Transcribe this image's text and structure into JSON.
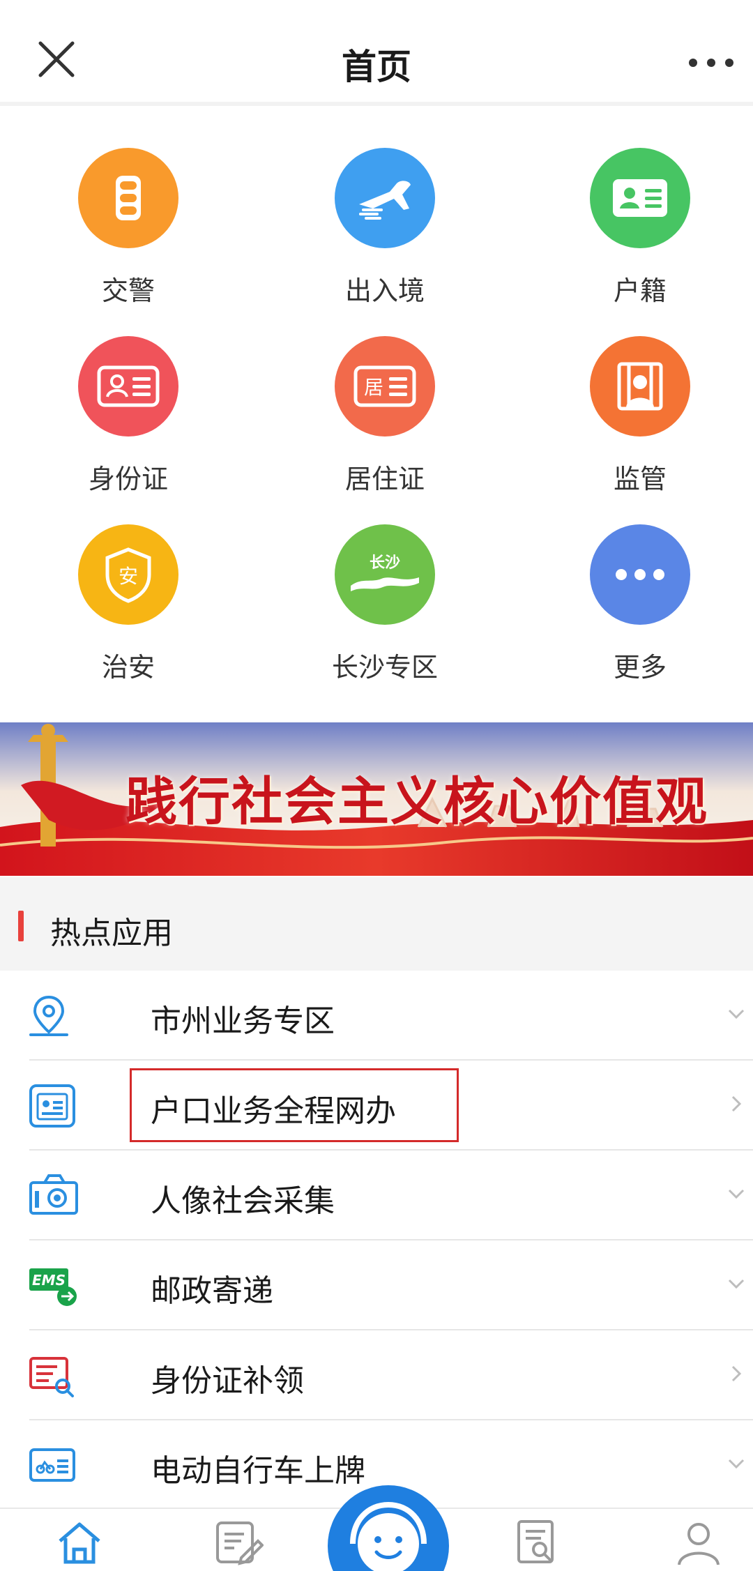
{
  "header": {
    "title": "首页",
    "close_icon": "close-icon",
    "more_icon": "more-dots-icon"
  },
  "services": [
    {
      "label": "交警",
      "icon": "traffic-light-icon",
      "color": "#f99a2c"
    },
    {
      "label": "出入境",
      "icon": "airplane-icon",
      "color": "#3f9ff0"
    },
    {
      "label": "户籍",
      "icon": "id-card-icon",
      "color": "#47c563"
    },
    {
      "label": "身份证",
      "icon": "identity-card-icon",
      "color": "#f0535a"
    },
    {
      "label": "居住证",
      "icon": "residence-permit-icon",
      "color": "#f26a4b"
    },
    {
      "label": "监管",
      "icon": "detention-icon",
      "color": "#f47334"
    },
    {
      "label": "治安",
      "icon": "shield-icon",
      "color": "#f7b514"
    },
    {
      "label": "长沙专区",
      "icon": "changsha-icon",
      "badge": "长沙",
      "color": "#6fc14a"
    },
    {
      "label": "更多",
      "icon": "more-icon",
      "color": "#5a86e6"
    }
  ],
  "banner": {
    "text": "践行社会主义核心价值观"
  },
  "hot_section": {
    "title": "热点应用",
    "accent": "#e8413c"
  },
  "list": [
    {
      "label": "市州业务专区",
      "icon": "location-pin-icon",
      "chevron": "chevron-down-icon"
    },
    {
      "label": "户口业务全程网办",
      "icon": "household-register-icon",
      "chevron": "chevron-right-icon"
    },
    {
      "label": "人像社会采集",
      "icon": "camera-icon",
      "chevron": "chevron-down-icon"
    },
    {
      "label": "邮政寄递",
      "icon": "ems-delivery-icon",
      "chevron": "chevron-down-icon"
    },
    {
      "label": "身份证补领",
      "icon": "id-reissue-icon",
      "chevron": "chevron-right-icon"
    },
    {
      "label": "电动自行车上牌",
      "icon": "ebike-plate-icon",
      "chevron": "chevron-down-icon"
    }
  ],
  "bottom_nav": [
    {
      "icon": "home-icon"
    },
    {
      "icon": "edit-form-icon"
    },
    {
      "icon": "customer-service-icon"
    },
    {
      "icon": "search-document-icon"
    },
    {
      "icon": "user-profile-icon"
    }
  ],
  "colors": {
    "list_icon_blue": "#2a8fe0",
    "highlight": "#d42a2a",
    "fab": "#1f7fe0"
  }
}
